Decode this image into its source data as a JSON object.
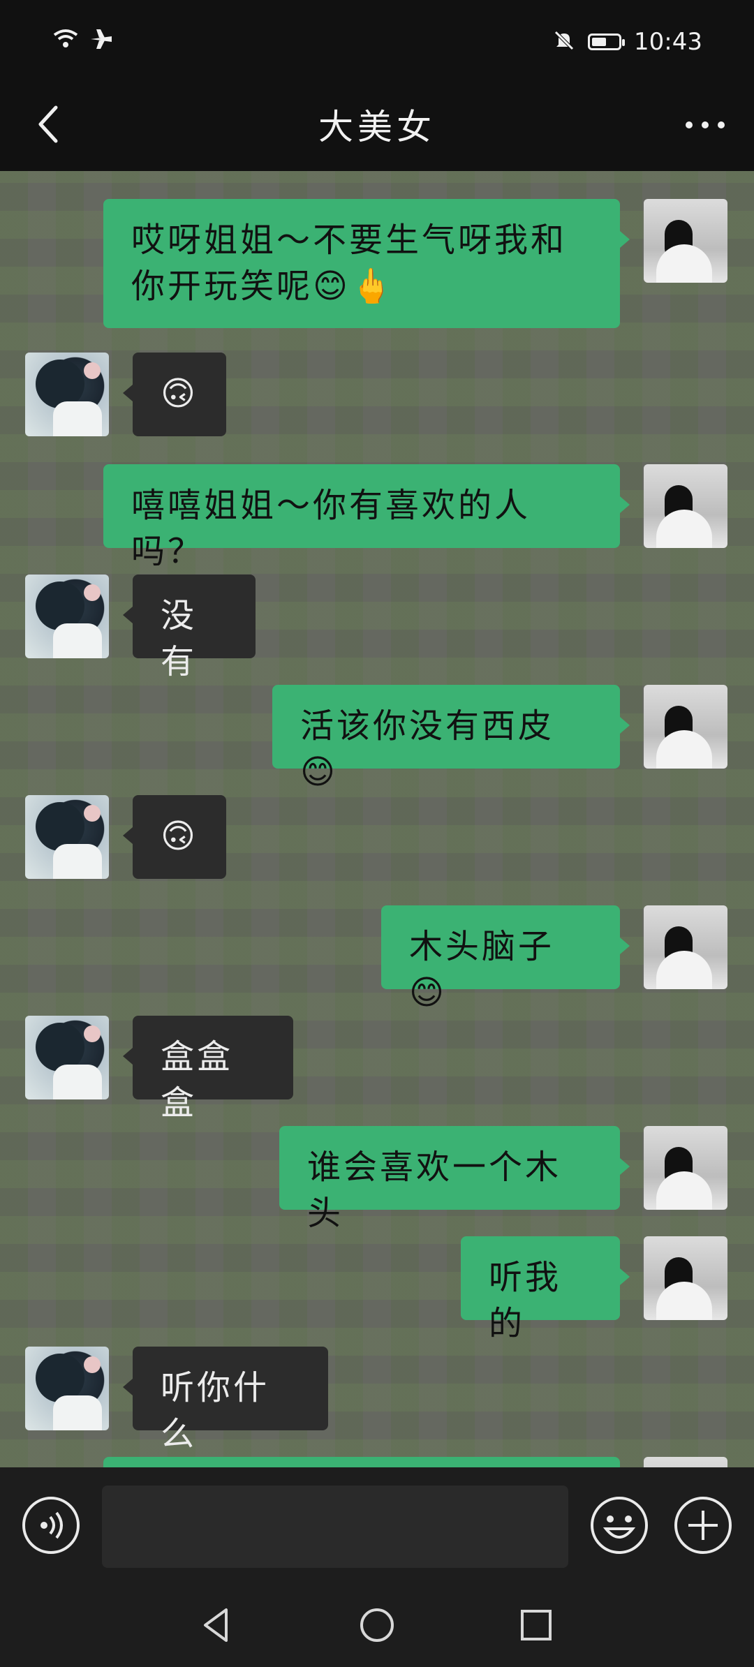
{
  "status_bar": {
    "time": "10:43"
  },
  "header": {
    "title": "大美女"
  },
  "messages": [
    {
      "from": "me",
      "text": "哎呀姐姐～不要生气呀我和你开玩笑呢😊🖕"
    },
    {
      "from": "other",
      "text": "🙃"
    },
    {
      "from": "me",
      "text": "嘻嘻姐姐～你有喜欢的人吗？"
    },
    {
      "from": "other",
      "text": "没有"
    },
    {
      "from": "me",
      "text": "活该你没有西皮😊"
    },
    {
      "from": "other",
      "text": "🙃"
    },
    {
      "from": "me",
      "text": "木头脑子😊"
    },
    {
      "from": "other",
      "text": "盒盒盒"
    },
    {
      "from": "me",
      "text": "谁会喜欢一个木头"
    },
    {
      "from": "me",
      "text": "听我的"
    },
    {
      "from": "other",
      "text": "听你什么"
    }
  ],
  "input": {
    "placeholder": ""
  },
  "icons": {
    "back": "chevron-left-icon",
    "more": "more-icon",
    "voice": "voice-icon",
    "emoji": "emoji-icon",
    "plus": "plus-icon",
    "wifi": "wifi-icon",
    "airplane": "airplane-icon",
    "mute": "bell-mute-icon",
    "battery": "battery-icon"
  },
  "battery_level": 0.55,
  "colors": {
    "bubble_me": "#3bb273",
    "bubble_other": "#2c2c2c",
    "background": "#111111"
  }
}
